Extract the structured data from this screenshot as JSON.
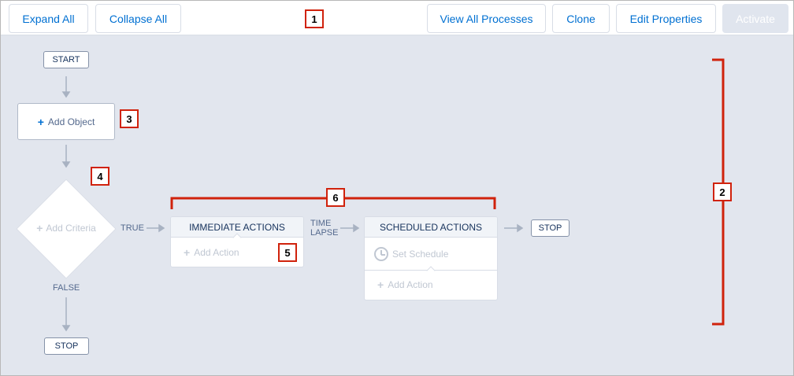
{
  "toolbar": {
    "expand_all": "Expand All",
    "collapse_all": "Collapse All",
    "view_all_processes": "View All Processes",
    "clone": "Clone",
    "edit_properties": "Edit Properties",
    "activate": "Activate"
  },
  "canvas": {
    "start_label": "START",
    "add_object_label": "Add Object",
    "add_criteria_label": "Add Criteria",
    "true_label": "TRUE",
    "false_label": "FALSE",
    "stop_label_bottom": "STOP",
    "stop_label_right": "STOP",
    "time_lapse_line1": "TIME",
    "time_lapse_line2": "LAPSE",
    "immediate_actions": {
      "title": "IMMEDIATE ACTIONS",
      "add_action_label": "Add Action"
    },
    "scheduled_actions": {
      "title": "SCHEDULED ACTIONS",
      "set_schedule_label": "Set Schedule",
      "add_action_label": "Add Action"
    }
  },
  "callouts": [
    "1",
    "2",
    "3",
    "4",
    "5",
    "6"
  ],
  "colors": {
    "accent": "#0070d2",
    "canvas_bg": "#e2e6ee",
    "callout_red": "#d0220c",
    "connector": "#a8b2c2"
  },
  "icons": {
    "plus": "plus-icon",
    "clock": "clock-icon"
  }
}
